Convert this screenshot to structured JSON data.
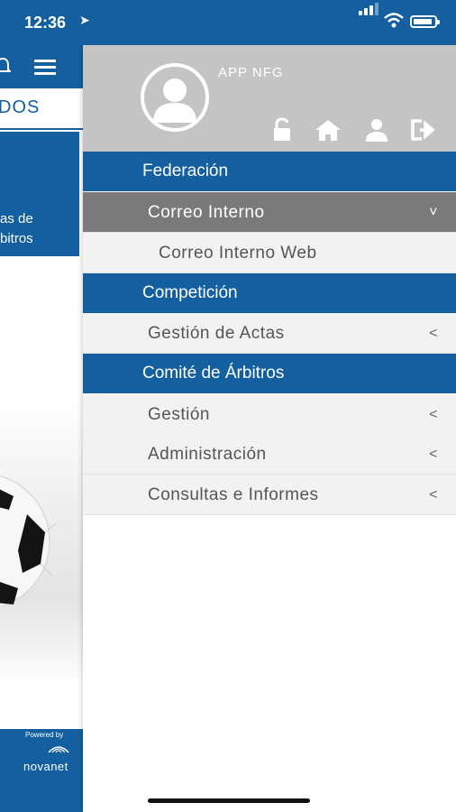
{
  "status": {
    "time": "12:36",
    "battery_level": 0.9
  },
  "background": {
    "tab_label": "DOS",
    "card_text": "as de\nbitros",
    "powered_label": "Powered by",
    "brand": "novanet"
  },
  "drawer": {
    "app_name": "APP NFG",
    "header_icons": [
      "unlock-icon",
      "home-icon",
      "user-icon",
      "logout-icon"
    ],
    "sections": [
      {
        "label": "Federación"
      },
      {
        "label": "Competición"
      },
      {
        "label": "Comité de Árbitros"
      }
    ],
    "items": [
      {
        "label": "Correo Interno",
        "chevron": "˅"
      },
      {
        "label": "Correo Interno Web"
      },
      {
        "label": "Gestión de Actas",
        "chevron": "<"
      },
      {
        "label": "Gestión",
        "chevron": "<"
      },
      {
        "label": "Administración",
        "chevron": "<"
      },
      {
        "label": "Consultas e Informes",
        "chevron": "<"
      }
    ]
  },
  "colors": {
    "primary": "#135fa0",
    "header_gray": "#c4c4c4",
    "active_gray": "#7a7a7a",
    "item_bg": "#f2f2f2"
  }
}
